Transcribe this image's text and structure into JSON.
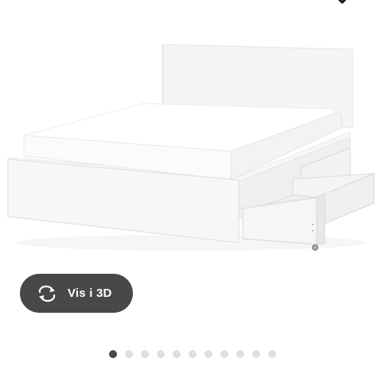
{
  "product_image": {
    "subject": "bed-frame-with-drawers",
    "colors": {
      "frame": "#f4f4f4",
      "mattress": "#ffffff",
      "shadow": "#e6e6e6"
    }
  },
  "top_icon": {
    "icon": "wishlist-heart-icon"
  },
  "view_3d_button": {
    "label": "Vis i 3D",
    "icon": "rotate-3d-icon",
    "background": "#484848",
    "text_color": "#ffffff"
  },
  "pagination": {
    "total": 11,
    "active_index": 0,
    "active_color": "#484848",
    "inactive_color": "#dfdfdf"
  }
}
